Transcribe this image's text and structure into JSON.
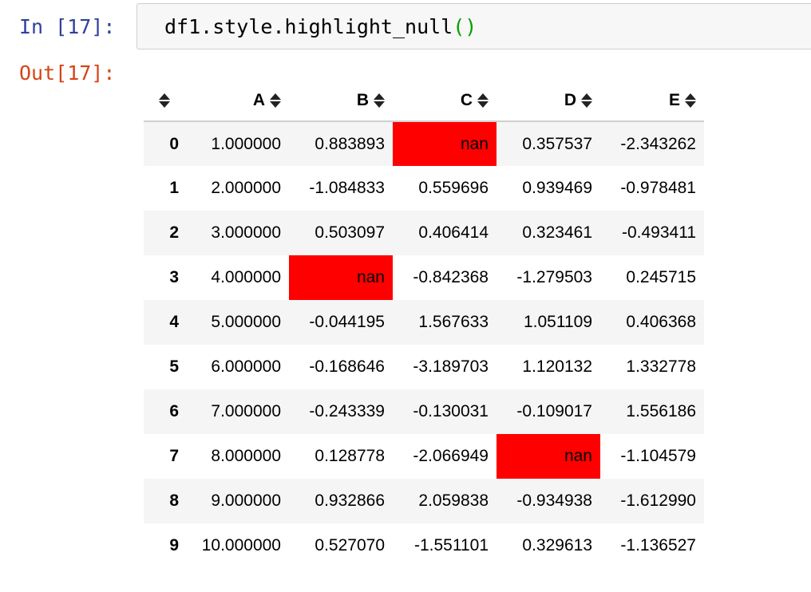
{
  "cell_in": {
    "prompt": "In [17]:",
    "code_text": "df1.style.highlight_null",
    "code_parens": "()"
  },
  "cell_out": {
    "prompt": "Out[17]:"
  },
  "table": {
    "columns": [
      "A",
      "B",
      "C",
      "D",
      "E"
    ],
    "highlight_color": "#ff0000",
    "rows": [
      {
        "index": "0",
        "cells": [
          "1.000000",
          "0.883893",
          "nan",
          "0.357537",
          "-2.343262"
        ],
        "nulls": [
          false,
          false,
          true,
          false,
          false
        ]
      },
      {
        "index": "1",
        "cells": [
          "2.000000",
          "-1.084833",
          "0.559696",
          "0.939469",
          "-0.978481"
        ],
        "nulls": [
          false,
          false,
          false,
          false,
          false
        ]
      },
      {
        "index": "2",
        "cells": [
          "3.000000",
          "0.503097",
          "0.406414",
          "0.323461",
          "-0.493411"
        ],
        "nulls": [
          false,
          false,
          false,
          false,
          false
        ]
      },
      {
        "index": "3",
        "cells": [
          "4.000000",
          "nan",
          "-0.842368",
          "-1.279503",
          "0.245715"
        ],
        "nulls": [
          false,
          true,
          false,
          false,
          false
        ]
      },
      {
        "index": "4",
        "cells": [
          "5.000000",
          "-0.044195",
          "1.567633",
          "1.051109",
          "0.406368"
        ],
        "nulls": [
          false,
          false,
          false,
          false,
          false
        ]
      },
      {
        "index": "5",
        "cells": [
          "6.000000",
          "-0.168646",
          "-3.189703",
          "1.120132",
          "1.332778"
        ],
        "nulls": [
          false,
          false,
          false,
          false,
          false
        ]
      },
      {
        "index": "6",
        "cells": [
          "7.000000",
          "-0.243339",
          "-0.130031",
          "-0.109017",
          "1.556186"
        ],
        "nulls": [
          false,
          false,
          false,
          false,
          false
        ]
      },
      {
        "index": "7",
        "cells": [
          "8.000000",
          "0.128778",
          "-2.066949",
          "nan",
          "-1.104579"
        ],
        "nulls": [
          false,
          false,
          false,
          true,
          false
        ]
      },
      {
        "index": "8",
        "cells": [
          "9.000000",
          "0.932866",
          "2.059838",
          "-0.934938",
          "-1.612990"
        ],
        "nulls": [
          false,
          false,
          false,
          false,
          false
        ]
      },
      {
        "index": "9",
        "cells": [
          "10.000000",
          "0.527070",
          "-1.551101",
          "0.329613",
          "-1.136527"
        ],
        "nulls": [
          false,
          false,
          false,
          false,
          false
        ]
      }
    ]
  }
}
